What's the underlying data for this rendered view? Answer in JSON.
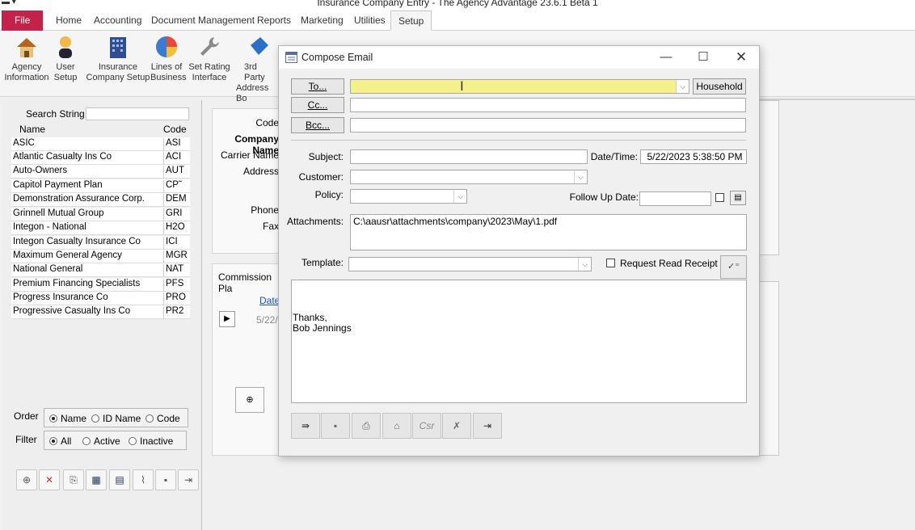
{
  "app": {
    "title": "Insurance Company Entry - The Agency Advantage 23.6.1 Beta 1"
  },
  "tabs": {
    "file": "File",
    "home": "Home",
    "accounting": "Accounting",
    "docmgmt": "Document Management",
    "reports": "Reports",
    "marketing": "Marketing",
    "utilities": "Utilities",
    "setup": "Setup"
  },
  "ribbon": {
    "agency": [
      "Agency",
      "Information"
    ],
    "user": [
      "User",
      "Setup"
    ],
    "insco": [
      "Insurance",
      "Company Setup"
    ],
    "lob": [
      "Lines of",
      "Business"
    ],
    "rating": [
      "Set Rating",
      "Interface"
    ],
    "thirdparty": [
      "3rd Party",
      "Address Bo"
    ]
  },
  "leftpanel": {
    "search_label": "Search String >",
    "search_value": "",
    "col_name": "Name",
    "col_code": "Code",
    "rows": [
      {
        "name": "ASIC",
        "code": "ASI"
      },
      {
        "name": "Atlantic Casualty Ins Co",
        "code": "ACI"
      },
      {
        "name": "Auto-Owners",
        "code": "AUT"
      },
      {
        "name": "Capitol Payment Plan",
        "code": "CP˜"
      },
      {
        "name": "Demonstration Assurance Corp.",
        "code": "DEM"
      },
      {
        "name": "Grinnell Mutual Group",
        "code": "GRI"
      },
      {
        "name": "Integon - National",
        "code": "H2O"
      },
      {
        "name": "Integon Casualty Insurance Co",
        "code": "ICI"
      },
      {
        "name": "Maximum General Agency",
        "code": "MGR"
      },
      {
        "name": "National General",
        "code": "NAT"
      },
      {
        "name": "Premium Financing Specialists",
        "code": "PFS"
      },
      {
        "name": "Progress Insurance Co",
        "code": "PRO"
      },
      {
        "name": "Progressive Casualty Ins Co",
        "code": "PR2"
      }
    ],
    "order_label": "Order",
    "order_opts": [
      "Name",
      "ID Name",
      "Code"
    ],
    "order_selected": "Name",
    "filter_label": "Filter",
    "filter_opts": [
      "All",
      "Active",
      "Inactive"
    ],
    "filter_selected": "All"
  },
  "midpanel": {
    "code": "Code",
    "company_name": "Company Name",
    "carrier_name": "Carrier Name",
    "address": "Address",
    "phone": "Phone",
    "fax": "Fax",
    "commission": "Commission Pla",
    "date_link": "Date",
    "date_val": "5/22/"
  },
  "dialog": {
    "title": "Compose Email",
    "to_btn": "To...",
    "cc_btn": "Cc...",
    "bcc_btn": "Bcc...",
    "household_btn": "Household",
    "to_value": "",
    "cc_value": "",
    "bcc_value": "",
    "subject_label": "Subject:",
    "subject_value": "",
    "datetime_label": "Date/Time:",
    "datetime_value": "5/22/2023 5:38:50 PM",
    "customer_label": "Customer:",
    "customer_value": "",
    "policy_label": "Policy:",
    "policy_value": "",
    "followup_label": "Follow Up Date:",
    "followup_value": "",
    "attachments_label": "Attachments:",
    "attachments_value": "C:\\aausr\\attachments\\company\\2023\\May\\1.pdf",
    "template_label": "Template:",
    "template_value": "",
    "read_receipt_label": "Request Read Receipt",
    "read_receipt_checked": false,
    "body_line1": "Thanks,",
    "body_line2": "Bob Jennings",
    "csr_label": "Csr"
  },
  "colors": {
    "file_tab": "#c3224a",
    "to_field_highlight": "#f4f08a",
    "link": "#1a4fd6"
  }
}
